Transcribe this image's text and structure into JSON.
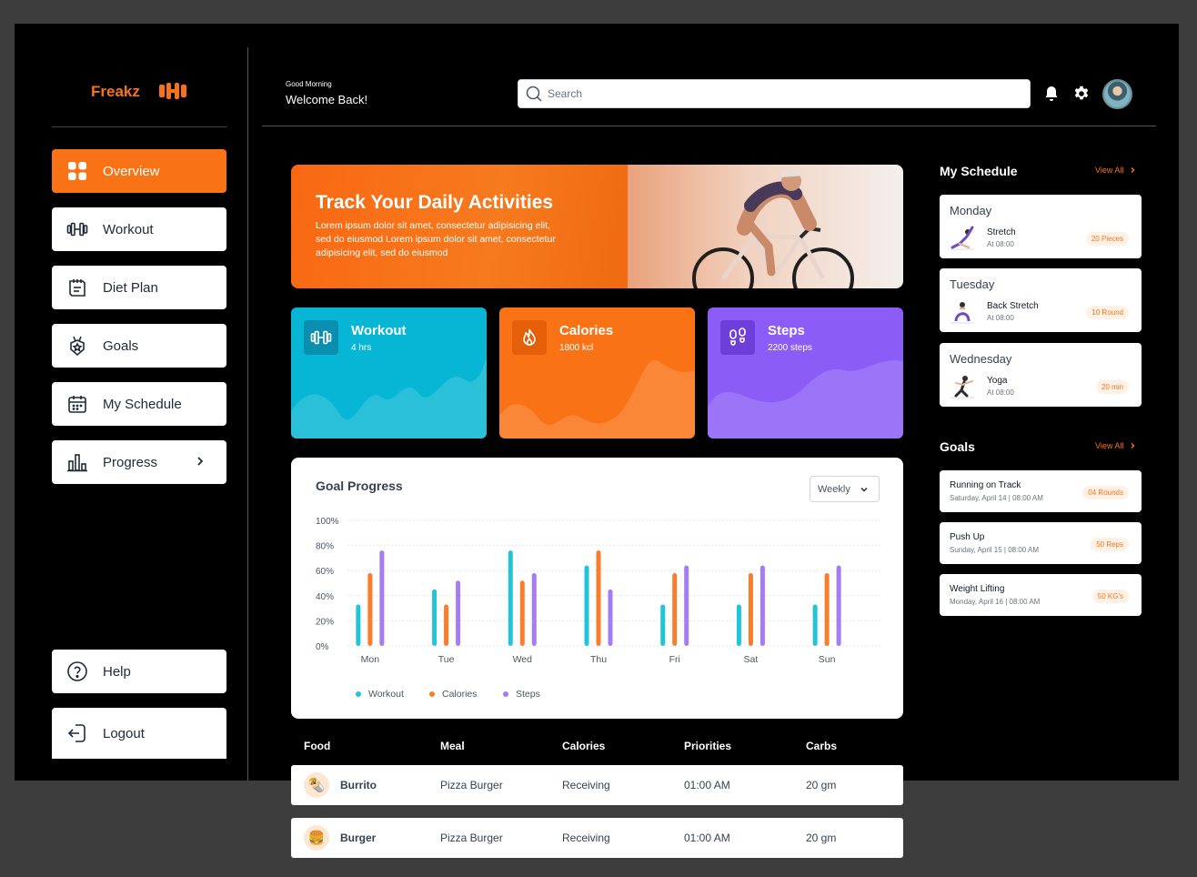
{
  "brand": "Freakz",
  "sidebar": {
    "items": [
      {
        "label": "Overview"
      },
      {
        "label": "Workout"
      },
      {
        "label": "Diet Plan"
      },
      {
        "label": "Goals"
      },
      {
        "label": "My Schedule"
      },
      {
        "label": "Progress"
      }
    ],
    "help": "Help",
    "logout": "Logout"
  },
  "header": {
    "greeting": "Good Morning",
    "welcome": "Welcome Back!",
    "search_placeholder": "Search"
  },
  "hero": {
    "title": "Track Your Daily Activities",
    "text": "Lorem ipsum dolor sit amet, consectetur adipisicing elit, sed do eiusmod Lorem ipsum dolor sit amet, consectetur adipisicing elit, sed do eiusmod"
  },
  "stats": [
    {
      "name": "Workout",
      "value": "4 hrs",
      "color": "#06b6d4",
      "icon": "dumbbell-icon"
    },
    {
      "name": "Calories",
      "value": "1800 kcl",
      "color": "#f97316",
      "icon": "flame-icon"
    },
    {
      "name": "Steps",
      "value": "2200 steps",
      "color": "#8b5cf6",
      "icon": "footsteps-icon"
    }
  ],
  "goal_progress": {
    "title": "Goal Progress",
    "period": "Weekly"
  },
  "chart_data": {
    "type": "bar",
    "categories": [
      "Mon",
      "Tue",
      "Wed",
      "Thu",
      "Fri",
      "Sat",
      "Sun"
    ],
    "series": [
      {
        "name": "Workout",
        "color": "#22c5d8",
        "values": [
          33,
          45,
          76,
          64,
          33,
          33,
          33
        ]
      },
      {
        "name": "Calories",
        "color": "#f97d2a",
        "values": [
          58,
          33,
          52,
          76,
          58,
          58,
          58
        ]
      },
      {
        "name": "Steps",
        "color": "#a57cf2",
        "values": [
          76,
          52,
          58,
          45,
          64,
          64,
          64
        ]
      }
    ],
    "yticks": [
      "100%",
      "80%",
      "60%",
      "40%",
      "20%",
      "0%"
    ],
    "ylim": [
      0,
      100
    ],
    "legend": "bottom-left",
    "grid": true
  },
  "food_table": {
    "headers": [
      "Food",
      "Meal",
      "Calories",
      "Priorities",
      "Carbs"
    ],
    "rows": [
      {
        "food": "Burrito",
        "meal": "Pizza Burger",
        "calories": "Receiving",
        "priority": "01:00 AM",
        "carbs": "20 gm",
        "icon": "🌯"
      },
      {
        "food": "Burger",
        "meal": "Pizza Burger",
        "calories": "Receiving",
        "priority": "01:00 AM",
        "carbs": "20 gm",
        "icon": "🍔"
      }
    ]
  },
  "schedule": {
    "title": "My Schedule",
    "view_all": "View All",
    "items": [
      {
        "day": "Monday",
        "activity": "Stretch",
        "time": "At 08:00",
        "badge": "20 Pieces"
      },
      {
        "day": "Tuesday",
        "activity": "Back Stretch",
        "time": "At 08:00",
        "badge": "10 Round"
      },
      {
        "day": "Wednesday",
        "activity": "Yoga",
        "time": "At 08:00",
        "badge": "20 min"
      }
    ]
  },
  "goals": {
    "title": "Goals",
    "view_all": "View All",
    "items": [
      {
        "name": "Running on Track",
        "date": "Saturday, April 14 | 08:00 AM",
        "badge": "04 Rounds"
      },
      {
        "name": "Push Up",
        "date": "Sunday, April 15 | 08:00 AM",
        "badge": "50 Reps"
      },
      {
        "name": "Weight Lifting",
        "date": "Monday, April 16 | 08:00 AM",
        "badge": "50 KG's"
      }
    ]
  }
}
